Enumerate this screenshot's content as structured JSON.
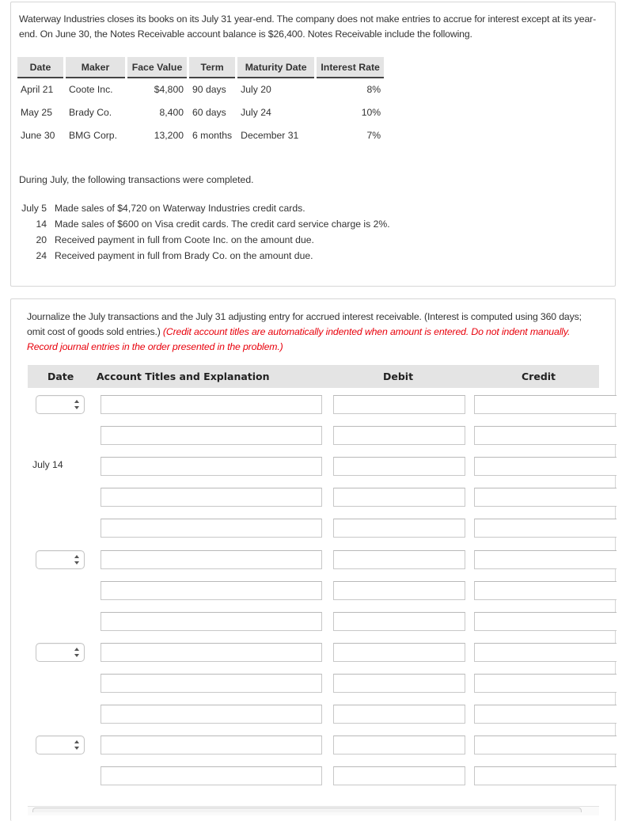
{
  "problem": {
    "intro": "Waterway Industries closes its books on its July 31 year-end. The company does not make entries to accrue for interest except at its year-end. On June 30, the Notes Receivable account balance is $26,400. Notes Receivable include the following.",
    "notes_table": {
      "headers": [
        "Date",
        "Maker",
        "Face Value",
        "Term",
        "Maturity Date",
        "Interest Rate"
      ],
      "rows": [
        [
          "April 21",
          "Coote Inc.",
          "$4,800",
          "90 days",
          "July 20",
          "8%"
        ],
        [
          "May 25",
          "Brady Co.",
          "8,400",
          "60 days",
          "July 24",
          "10%"
        ],
        [
          "June 30",
          "BMG Corp.",
          "13,200",
          "6 months",
          "December 31",
          "7%"
        ]
      ]
    },
    "during_text": "During July, the following transactions were completed.",
    "transactions": [
      {
        "date": "July 5",
        "text": "Made sales of $4,720 on Waterway Industries credit cards."
      },
      {
        "date": "14",
        "text": "Made sales of $600 on Visa credit cards. The credit card service charge is 2%."
      },
      {
        "date": "20",
        "text": "Received payment in full from Coote Inc. on the amount due."
      },
      {
        "date": "24",
        "text": "Received payment in full from Brady Co. on the amount due."
      }
    ]
  },
  "question": {
    "instruction": "Journalize the July transactions and the July 31 adjusting entry for accrued interest receivable. (Interest is computed using 360 days; omit cost of goods sold entries.) ",
    "instruction_red": "(Credit account titles are automatically indented when amount is entered. Do not indent manually. Record journal entries in the order presented in the problem.)",
    "journal": {
      "headers": {
        "date": "Date",
        "account": "Account Titles and Explanation",
        "debit": "Debit",
        "credit": "Credit"
      },
      "rows": [
        {
          "date_type": "select",
          "date_value": "",
          "account": "",
          "debit": "",
          "credit": ""
        },
        {
          "date_type": "none",
          "account": "",
          "debit": "",
          "credit": ""
        },
        {
          "date_type": "label",
          "date_value": "July 14",
          "account": "",
          "debit": "",
          "credit": ""
        },
        {
          "date_type": "none",
          "account": "",
          "debit": "",
          "credit": ""
        },
        {
          "date_type": "none",
          "account": "",
          "debit": "",
          "credit": ""
        },
        {
          "date_type": "select",
          "date_value": "",
          "account": "",
          "debit": "",
          "credit": ""
        },
        {
          "date_type": "none",
          "account": "",
          "debit": "",
          "credit": ""
        },
        {
          "date_type": "none",
          "account": "",
          "debit": "",
          "credit": ""
        },
        {
          "date_type": "select",
          "date_value": "",
          "account": "",
          "debit": "",
          "credit": ""
        },
        {
          "date_type": "none",
          "account": "",
          "debit": "",
          "credit": ""
        },
        {
          "date_type": "none",
          "account": "",
          "debit": "",
          "credit": ""
        },
        {
          "date_type": "select",
          "date_value": "",
          "account": "",
          "debit": "",
          "credit": ""
        },
        {
          "date_type": "none",
          "account": "",
          "debit": "",
          "credit": ""
        }
      ]
    }
  }
}
